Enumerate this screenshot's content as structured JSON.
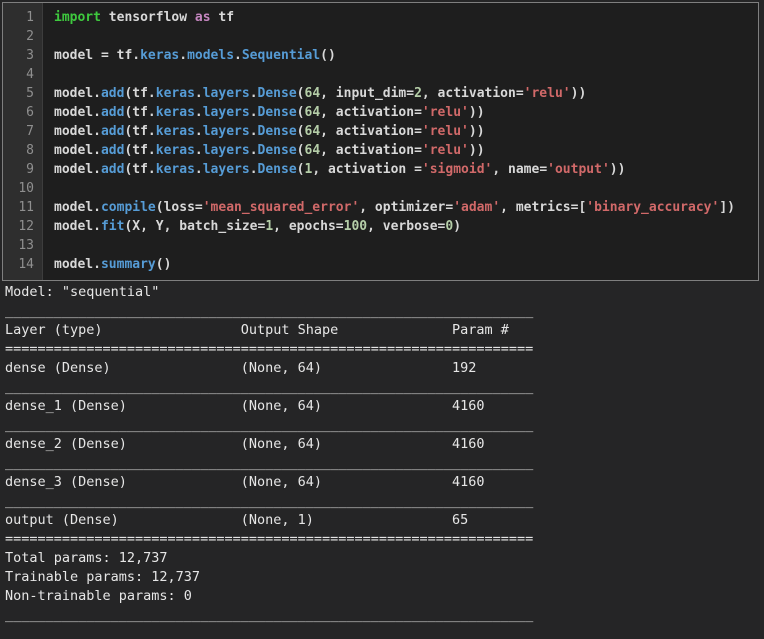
{
  "editor": {
    "lines": [
      {
        "n": "1",
        "tokens": [
          {
            "t": "import",
            "c": "kw"
          },
          {
            "t": " tensorflow ",
            "c": "p"
          },
          {
            "t": "as",
            "c": "kw2"
          },
          {
            "t": " tf",
            "c": "p"
          }
        ]
      },
      {
        "n": "2",
        "tokens": []
      },
      {
        "n": "3",
        "tokens": [
          {
            "t": "model = tf.",
            "c": "p"
          },
          {
            "t": "keras",
            "c": "at"
          },
          {
            "t": ".",
            "c": "p"
          },
          {
            "t": "models",
            "c": "at"
          },
          {
            "t": ".",
            "c": "p"
          },
          {
            "t": "Sequential",
            "c": "at"
          },
          {
            "t": "()",
            "c": "p"
          }
        ]
      },
      {
        "n": "4",
        "tokens": []
      },
      {
        "n": "5",
        "tokens": [
          {
            "t": "model.",
            "c": "p"
          },
          {
            "t": "add",
            "c": "at"
          },
          {
            "t": "(tf.",
            "c": "p"
          },
          {
            "t": "keras",
            "c": "at"
          },
          {
            "t": ".",
            "c": "p"
          },
          {
            "t": "layers",
            "c": "at"
          },
          {
            "t": ".",
            "c": "p"
          },
          {
            "t": "Dense",
            "c": "at"
          },
          {
            "t": "(",
            "c": "p"
          },
          {
            "t": "64",
            "c": "num"
          },
          {
            "t": ", input_dim=",
            "c": "p"
          },
          {
            "t": "2",
            "c": "num"
          },
          {
            "t": ", activation=",
            "c": "p"
          },
          {
            "t": "'relu'",
            "c": "str"
          },
          {
            "t": "))",
            "c": "p"
          }
        ]
      },
      {
        "n": "6",
        "tokens": [
          {
            "t": "model.",
            "c": "p"
          },
          {
            "t": "add",
            "c": "at"
          },
          {
            "t": "(tf.",
            "c": "p"
          },
          {
            "t": "keras",
            "c": "at"
          },
          {
            "t": ".",
            "c": "p"
          },
          {
            "t": "layers",
            "c": "at"
          },
          {
            "t": ".",
            "c": "p"
          },
          {
            "t": "Dense",
            "c": "at"
          },
          {
            "t": "(",
            "c": "p"
          },
          {
            "t": "64",
            "c": "num"
          },
          {
            "t": ", activation=",
            "c": "p"
          },
          {
            "t": "'relu'",
            "c": "str"
          },
          {
            "t": "))",
            "c": "p"
          }
        ]
      },
      {
        "n": "7",
        "tokens": [
          {
            "t": "model.",
            "c": "p"
          },
          {
            "t": "add",
            "c": "at"
          },
          {
            "t": "(tf.",
            "c": "p"
          },
          {
            "t": "keras",
            "c": "at"
          },
          {
            "t": ".",
            "c": "p"
          },
          {
            "t": "layers",
            "c": "at"
          },
          {
            "t": ".",
            "c": "p"
          },
          {
            "t": "Dense",
            "c": "at"
          },
          {
            "t": "(",
            "c": "p"
          },
          {
            "t": "64",
            "c": "num"
          },
          {
            "t": ", activation=",
            "c": "p"
          },
          {
            "t": "'relu'",
            "c": "str"
          },
          {
            "t": "))",
            "c": "p"
          }
        ]
      },
      {
        "n": "8",
        "tokens": [
          {
            "t": "model.",
            "c": "p"
          },
          {
            "t": "add",
            "c": "at"
          },
          {
            "t": "(tf.",
            "c": "p"
          },
          {
            "t": "keras",
            "c": "at"
          },
          {
            "t": ".",
            "c": "p"
          },
          {
            "t": "layers",
            "c": "at"
          },
          {
            "t": ".",
            "c": "p"
          },
          {
            "t": "Dense",
            "c": "at"
          },
          {
            "t": "(",
            "c": "p"
          },
          {
            "t": "64",
            "c": "num"
          },
          {
            "t": ", activation=",
            "c": "p"
          },
          {
            "t": "'relu'",
            "c": "str"
          },
          {
            "t": "))",
            "c": "p"
          }
        ]
      },
      {
        "n": "9",
        "tokens": [
          {
            "t": "model.",
            "c": "p"
          },
          {
            "t": "add",
            "c": "at"
          },
          {
            "t": "(tf.",
            "c": "p"
          },
          {
            "t": "keras",
            "c": "at"
          },
          {
            "t": ".",
            "c": "p"
          },
          {
            "t": "layers",
            "c": "at"
          },
          {
            "t": ".",
            "c": "p"
          },
          {
            "t": "Dense",
            "c": "at"
          },
          {
            "t": "(",
            "c": "p"
          },
          {
            "t": "1",
            "c": "num"
          },
          {
            "t": ", activation =",
            "c": "p"
          },
          {
            "t": "'sigmoid'",
            "c": "str"
          },
          {
            "t": ", name=",
            "c": "p"
          },
          {
            "t": "'output'",
            "c": "str"
          },
          {
            "t": "))",
            "c": "p"
          }
        ]
      },
      {
        "n": "10",
        "tokens": []
      },
      {
        "n": "11",
        "tokens": [
          {
            "t": "model.",
            "c": "p"
          },
          {
            "t": "compile",
            "c": "at"
          },
          {
            "t": "(loss=",
            "c": "p"
          },
          {
            "t": "'mean_squared_error'",
            "c": "str"
          },
          {
            "t": ", optimizer=",
            "c": "p"
          },
          {
            "t": "'adam'",
            "c": "str"
          },
          {
            "t": ", metrics=[",
            "c": "p"
          },
          {
            "t": "'binary_accuracy'",
            "c": "str"
          },
          {
            "t": "])",
            "c": "p"
          }
        ]
      },
      {
        "n": "12",
        "tokens": [
          {
            "t": "model.",
            "c": "p"
          },
          {
            "t": "fit",
            "c": "at"
          },
          {
            "t": "(X, Y, batch_size=",
            "c": "p"
          },
          {
            "t": "1",
            "c": "num"
          },
          {
            "t": ", epochs=",
            "c": "p"
          },
          {
            "t": "100",
            "c": "num"
          },
          {
            "t": ", verbose=",
            "c": "p"
          },
          {
            "t": "0",
            "c": "num"
          },
          {
            "t": ")",
            "c": "p"
          }
        ]
      },
      {
        "n": "13",
        "tokens": []
      },
      {
        "n": "14",
        "tokens": [
          {
            "t": "model.",
            "c": "p"
          },
          {
            "t": "summary",
            "c": "at"
          },
          {
            "t": "()",
            "c": "p"
          }
        ]
      }
    ]
  },
  "console": {
    "lines": [
      "Model: \"sequential\"",
      "_________________________________________________________________",
      "Layer (type)                 Output Shape              Param #   ",
      "=================================================================",
      "dense (Dense)                (None, 64)                192       ",
      "_________________________________________________________________",
      "dense_1 (Dense)              (None, 64)                4160      ",
      "_________________________________________________________________",
      "dense_2 (Dense)              (None, 64)                4160      ",
      "_________________________________________________________________",
      "dense_3 (Dense)              (None, 64)                4160      ",
      "_________________________________________________________________",
      "output (Dense)               (None, 1)                 65        ",
      "=================================================================",
      "Total params: 12,737",
      "Trainable params: 12,737",
      "Non-trainable params: 0",
      "_________________________________________________________________"
    ]
  },
  "colors": {
    "page_background": "#252526",
    "editor_background": "#1e1e1e",
    "gutter_background": "#2e2e2e",
    "editor_border": "#7f7f7f",
    "keyword_green": "#3ec93e",
    "keyword_pink": "#c586c0",
    "attribute_blue": "#569cd6",
    "number_green": "#b5cea8",
    "string_red": "#d16969",
    "default_text": "#d8d8d8",
    "console_text": "#e6e6e6",
    "line_number": "#8f8f8f"
  }
}
